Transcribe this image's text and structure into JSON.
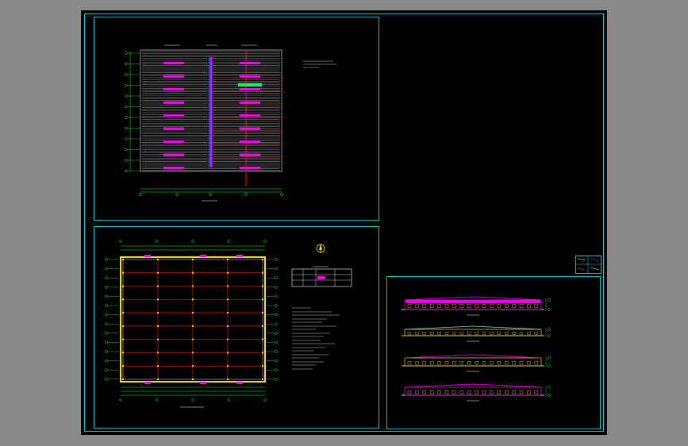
{
  "colors": {
    "background": "#000000",
    "viewport": "#8a8a8a",
    "frame": "#00c8d0",
    "grid_red": "#e01818",
    "column_yellow": "#ffe000",
    "roof_gray": "#bdbdbd",
    "magenta": "#ff00ff",
    "green": "#00ff3c",
    "white": "#ffffff"
  },
  "drawings": {
    "roof_plan": {
      "icon": "roof-plan-drawing"
    },
    "floor_plan": {
      "icon": "floor-plan-drawing",
      "grid_cols": 4,
      "grid_rows": 9
    },
    "elevations": {
      "icon": "elevation-drawings",
      "count": 4
    },
    "title_block": {
      "icon": "title-block"
    },
    "notes": {
      "icon": "notes-text"
    },
    "legend_table": {
      "icon": "door-window-table"
    },
    "north_arrow": {
      "icon": "north-arrow-icon"
    }
  }
}
